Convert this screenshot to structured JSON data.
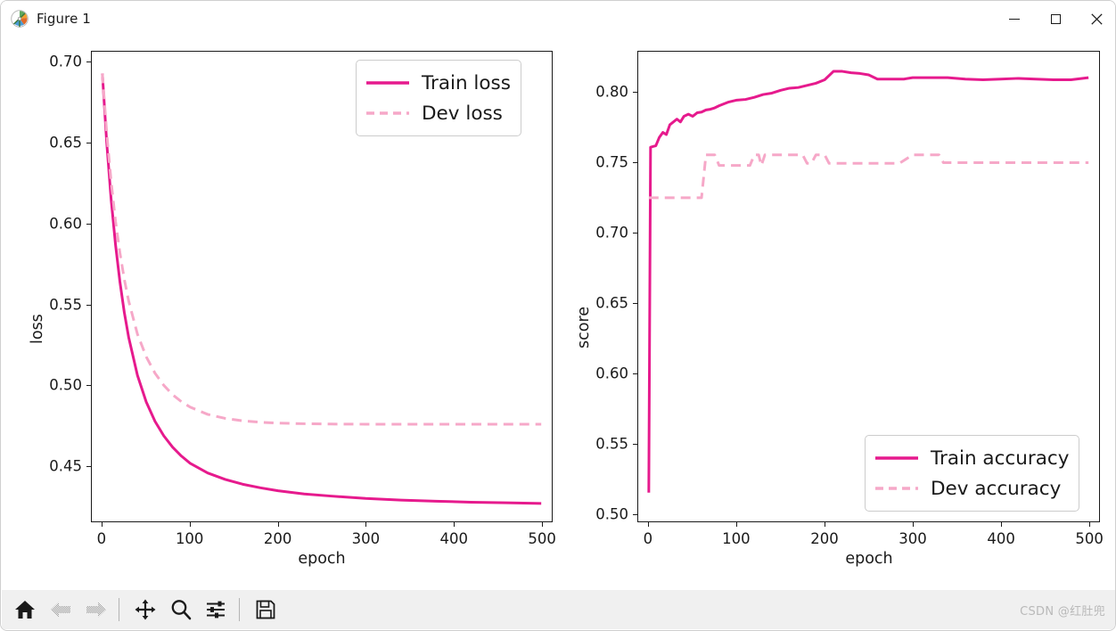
{
  "window": {
    "title": "Figure 1",
    "icon": "matplotlib-icon",
    "minimize_label": "Minimize",
    "maximize_label": "Maximize",
    "close_label": "Close"
  },
  "toolbar": {
    "buttons": [
      {
        "name": "home-icon",
        "label": "Home",
        "enabled": true
      },
      {
        "name": "back-arrow-icon",
        "label": "Back",
        "enabled": false
      },
      {
        "name": "forward-arrow-icon",
        "label": "Forward",
        "enabled": false
      },
      {
        "name": "pan-move-icon",
        "label": "Pan",
        "enabled": true
      },
      {
        "name": "zoom-magnifier-icon",
        "label": "Zoom to rectangle",
        "enabled": true
      },
      {
        "name": "subplot-sliders-icon",
        "label": "Configure subplots",
        "enabled": true
      },
      {
        "name": "save-floppy-icon",
        "label": "Save the figure",
        "enabled": true
      }
    ],
    "watermark": "CSDN @红肚兜"
  },
  "colors": {
    "train": "#E61A8D",
    "dev": "#F6A8C8",
    "axis": "#1a1a1a",
    "figure_background": "#ffffff",
    "toolbar_background": "#f0f0f0"
  },
  "chart_data": [
    {
      "type": "line",
      "id": "loss-plot",
      "title": "",
      "xlabel": "epoch",
      "ylabel": "loss",
      "xlim": [
        -12,
        512
      ],
      "ylim": [
        0.4155,
        0.7065
      ],
      "xticks": [
        0,
        100,
        200,
        300,
        400,
        500
      ],
      "yticks": [
        0.45,
        0.5,
        0.55,
        0.6,
        0.65,
        0.7
      ],
      "grid": false,
      "legend_position": "upper right",
      "series": [
        {
          "name": "Train loss",
          "style": "solid",
          "color": "#E61A8D",
          "x": [
            0,
            5,
            10,
            15,
            20,
            25,
            30,
            40,
            50,
            60,
            70,
            80,
            90,
            100,
            120,
            140,
            160,
            180,
            200,
            230,
            260,
            300,
            340,
            380,
            420,
            460,
            500
          ],
          "y": [
            0.693,
            0.65,
            0.615,
            0.587,
            0.564,
            0.545,
            0.5295,
            0.506,
            0.4895,
            0.4775,
            0.4685,
            0.4615,
            0.456,
            0.4515,
            0.4455,
            0.4415,
            0.4385,
            0.4363,
            0.4345,
            0.4325,
            0.4312,
            0.4297,
            0.4287,
            0.428,
            0.4274,
            0.427,
            0.4266
          ]
        },
        {
          "name": "Dev loss",
          "style": "dashed",
          "color": "#F6A8C8",
          "x": [
            0,
            5,
            10,
            15,
            20,
            25,
            30,
            40,
            50,
            60,
            70,
            80,
            90,
            100,
            120,
            140,
            160,
            180,
            200,
            230,
            260,
            300,
            340,
            380,
            420,
            460,
            500
          ],
          "y": [
            0.693,
            0.656,
            0.626,
            0.6015,
            0.582,
            0.5655,
            0.552,
            0.5315,
            0.5175,
            0.5073,
            0.4998,
            0.494,
            0.4897,
            0.4863,
            0.4818,
            0.4793,
            0.4778,
            0.4769,
            0.4764,
            0.476,
            0.4758,
            0.4757,
            0.4757,
            0.4757,
            0.4757,
            0.4757,
            0.4757
          ]
        }
      ]
    },
    {
      "type": "line",
      "id": "accuracy-plot",
      "title": "",
      "xlabel": "epoch",
      "ylabel": "score",
      "xlim": [
        -12,
        512
      ],
      "ylim": [
        0.4945,
        0.829
      ],
      "xticks": [
        0,
        100,
        200,
        300,
        400,
        500
      ],
      "yticks": [
        0.5,
        0.55,
        0.6,
        0.65,
        0.7,
        0.75,
        0.8
      ],
      "grid": false,
      "legend_position": "lower right",
      "series": [
        {
          "name": "Train accuracy",
          "style": "solid",
          "color": "#E61A8D",
          "x": [
            0,
            2,
            5,
            8,
            12,
            16,
            20,
            24,
            28,
            32,
            36,
            40,
            45,
            50,
            55,
            60,
            65,
            70,
            75,
            80,
            90,
            100,
            110,
            120,
            130,
            140,
            150,
            160,
            170,
            180,
            190,
            200,
            210,
            220,
            230,
            240,
            250,
            260,
            275,
            290,
            300,
            320,
            340,
            360,
            380,
            400,
            420,
            440,
            460,
            480,
            500
          ],
          "y": [
            0.515,
            0.761,
            0.7615,
            0.762,
            0.768,
            0.7715,
            0.77,
            0.777,
            0.779,
            0.781,
            0.779,
            0.783,
            0.7845,
            0.783,
            0.7855,
            0.786,
            0.7875,
            0.788,
            0.789,
            0.7905,
            0.793,
            0.7945,
            0.795,
            0.7965,
            0.7985,
            0.7995,
            0.8015,
            0.803,
            0.8035,
            0.805,
            0.8065,
            0.809,
            0.815,
            0.815,
            0.814,
            0.8135,
            0.8125,
            0.8095,
            0.8095,
            0.8095,
            0.8105,
            0.8105,
            0.8105,
            0.8095,
            0.809,
            0.8095,
            0.81,
            0.8095,
            0.809,
            0.809,
            0.8105
          ]
        },
        {
          "name": "Dev accuracy",
          "style": "dashed",
          "color": "#F6A8C8",
          "x": [
            0,
            5,
            40,
            45,
            60,
            65,
            75,
            80,
            115,
            120,
            125,
            128,
            132,
            175,
            180,
            185,
            190,
            195,
            200,
            205,
            210,
            280,
            285,
            300,
            305,
            330,
            335,
            500
          ],
          "y": [
            0.725,
            0.725,
            0.725,
            0.725,
            0.725,
            0.7555,
            0.7555,
            0.748,
            0.748,
            0.7555,
            0.7555,
            0.748,
            0.7555,
            0.7555,
            0.7495,
            0.7495,
            0.7555,
            0.7555,
            0.7555,
            0.7495,
            0.7495,
            0.7495,
            0.7495,
            0.7555,
            0.7555,
            0.7555,
            0.75,
            0.75
          ]
        }
      ]
    }
  ],
  "legends": {
    "loss": [
      {
        "label": "Train loss",
        "style": "solid",
        "color": "#E61A8D"
      },
      {
        "label": "Dev loss",
        "style": "dashed",
        "color": "#F6A8C8"
      }
    ],
    "accuracy": [
      {
        "label": "Train accuracy",
        "style": "solid",
        "color": "#E61A8D"
      },
      {
        "label": "Dev accuracy",
        "style": "dashed",
        "color": "#F6A8C8"
      }
    ]
  }
}
